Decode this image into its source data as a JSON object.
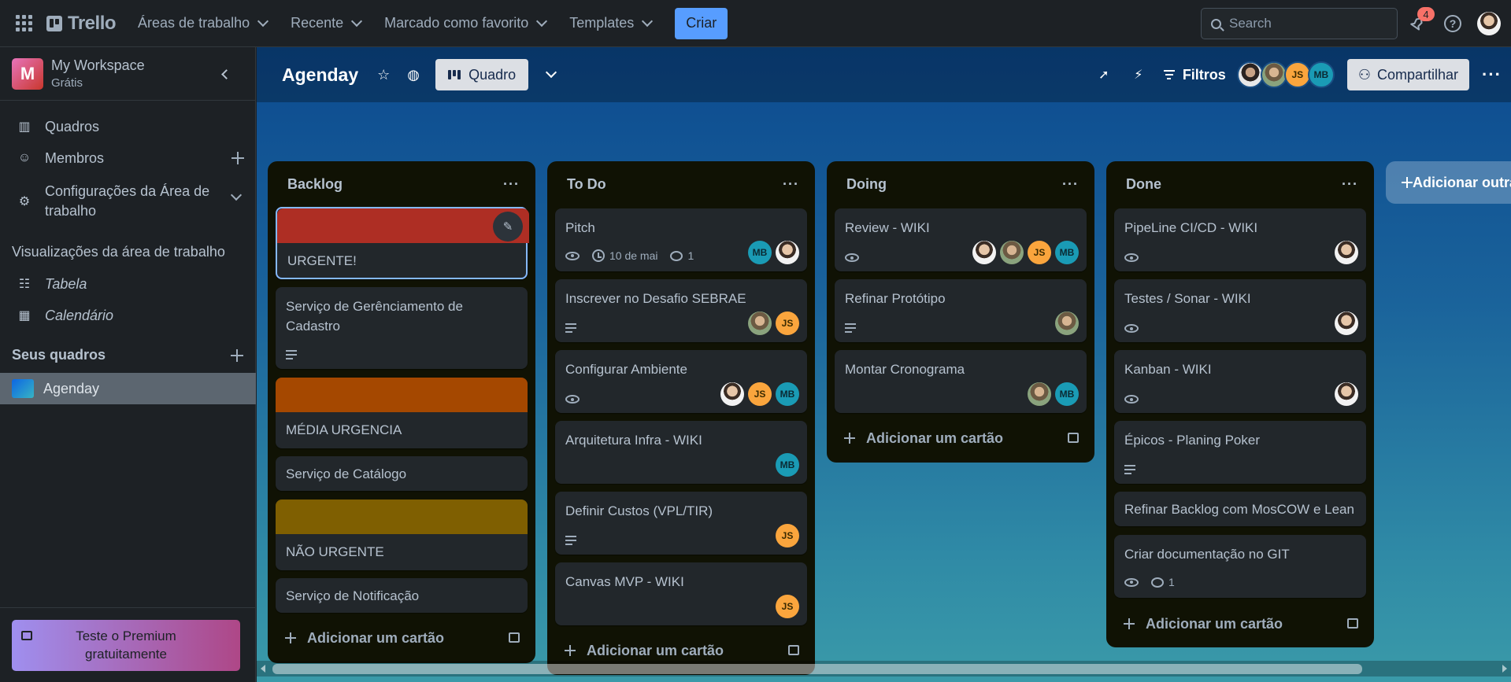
{
  "topbar": {
    "logo_text": "Trello",
    "nav": [
      {
        "label": "Áreas de trabalho"
      },
      {
        "label": "Recente"
      },
      {
        "label": "Marcado como favorito"
      },
      {
        "label": "Templates"
      }
    ],
    "create_label": "Criar",
    "search_placeholder": "Search",
    "notifications_count": "4"
  },
  "sidebar": {
    "workspace_initial": "M",
    "workspace_name": "My Workspace",
    "workspace_plan": "Grátis",
    "items": [
      {
        "label": "Quadros"
      },
      {
        "label": "Membros"
      },
      {
        "label": "Configurações da Área de trabalho"
      }
    ],
    "views_heading": "Visualizações da área de trabalho",
    "views": [
      {
        "label": "Tabela"
      },
      {
        "label": "Calendário"
      }
    ],
    "boards_heading": "Seus quadros",
    "boards": [
      {
        "label": "Agenday"
      }
    ],
    "premium_label": "Teste o Premium gratuitamente"
  },
  "board": {
    "title": "Agenday",
    "view_label": "Quadro",
    "filters_label": "Filtros",
    "share_label": "Compartilhar",
    "add_list_label": "Adicionar outra lista",
    "add_card_label": "Adicionar um cartão",
    "header_members": [
      "",
      "",
      "JS",
      "MB"
    ],
    "lists": [
      {
        "title": "Backlog",
        "cards": [
          {
            "title": "URGENTE!",
            "cover": "#ae2e24"
          },
          {
            "title": "Serviço de Gerênciamento de Cadastro"
          },
          {
            "title": "MÉDIA URGENCIA",
            "cover": "#a54800"
          },
          {
            "title": "Serviço de Catálogo"
          },
          {
            "title": "NÃO URGENTE",
            "cover": "#7f5f01"
          },
          {
            "title": "Serviço de Notificação"
          }
        ]
      },
      {
        "title": "To Do",
        "cards": [
          {
            "title": "Pitch",
            "due": "10 de mai",
            "comments": "1",
            "members": [
              "MB",
              ""
            ]
          },
          {
            "title": "Inscrever no Desafio SEBRAE",
            "members": [
              "",
              "JS"
            ]
          },
          {
            "title": "Configurar Ambiente",
            "members": [
              "",
              "JS",
              "MB"
            ]
          },
          {
            "title": "Arquitetura Infra - WIKI",
            "members": [
              "MB"
            ]
          },
          {
            "title": "Definir Custos (VPL/TIR)",
            "members": [
              "JS"
            ]
          },
          {
            "title": "Canvas MVP - WIKI",
            "members": [
              "JS"
            ]
          }
        ]
      },
      {
        "title": "Doing",
        "cards": [
          {
            "title": "Review - WIKI",
            "members": [
              "",
              "",
              "JS",
              "MB"
            ]
          },
          {
            "title": "Refinar Protótipo",
            "members": [
              ""
            ]
          },
          {
            "title": "Montar Cronograma",
            "members": [
              "",
              "MB"
            ]
          }
        ]
      },
      {
        "title": "Done",
        "cards": [
          {
            "title": "PipeLine CI/CD - WIKI",
            "members": [
              ""
            ]
          },
          {
            "title": "Testes / Sonar - WIKI",
            "members": [
              ""
            ]
          },
          {
            "title": "Kanban - WIKI",
            "members": [
              ""
            ]
          },
          {
            "title": "Épicos - Planing Poker"
          },
          {
            "title": "Refinar Backlog com MosCOW e Lean"
          },
          {
            "title": "Criar documentação no GIT",
            "comments": "1"
          }
        ]
      }
    ]
  },
  "colors": {
    "accent": "#579dff",
    "list_bg": "#101204",
    "card_bg": "#22272b"
  }
}
